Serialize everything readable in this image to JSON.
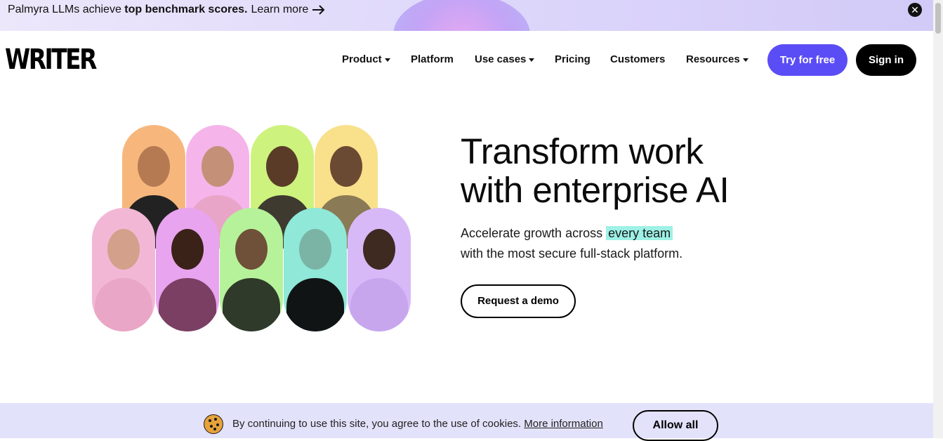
{
  "announcement": {
    "text_prefix": "Palmyra LLMs achieve ",
    "text_bold": "top benchmark scores.",
    "link": "Learn more",
    "close": "✕"
  },
  "header": {
    "logo": "WRITER",
    "nav": [
      {
        "label": "Product",
        "dropdown": true
      },
      {
        "label": "Platform",
        "dropdown": false
      },
      {
        "label": "Use cases",
        "dropdown": true
      },
      {
        "label": "Pricing",
        "dropdown": false
      },
      {
        "label": "Customers",
        "dropdown": false
      },
      {
        "label": "Resources",
        "dropdown": true
      }
    ],
    "try_label": "Try for free",
    "signin_label": "Sign in"
  },
  "hero": {
    "headline_line1": "Transform work",
    "headline_line2": "with enterprise AI",
    "sub_before": "Accelerate growth across ",
    "sub_highlight": "every team",
    "sub_line2": "with the most secure full-stack platform.",
    "demo_label": "Request a demo"
  },
  "cookie": {
    "text": "By continuing to use this site, you agree to the use of cookies. ",
    "more": "More information",
    "allow": "Allow all"
  },
  "colors": {
    "accent": "#5b4df5",
    "highlight": "#9ef1e6",
    "cookie_bg": "#e3e2fb"
  }
}
